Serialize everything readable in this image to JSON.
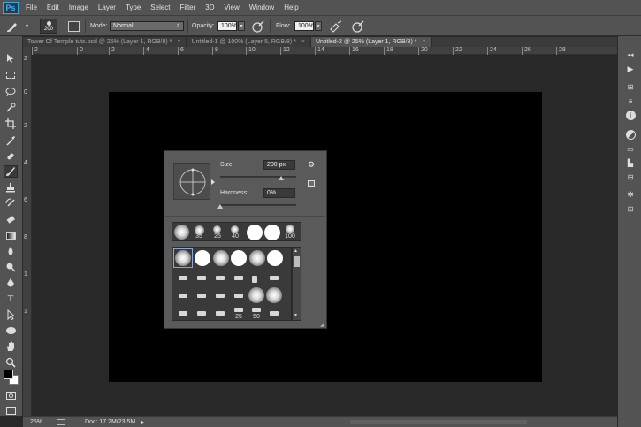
{
  "app": {
    "logo": "Ps",
    "accent": "#31a8ff"
  },
  "menu": [
    "File",
    "Edit",
    "Image",
    "Layer",
    "Type",
    "Select",
    "Filter",
    "3D",
    "View",
    "Window",
    "Help"
  ],
  "options": {
    "brush_size": "200",
    "mode_label": "Mode:",
    "mode_value": "Normal",
    "opacity_label": "Opacity:",
    "opacity_value": "100%",
    "flow_label": "Flow:",
    "flow_value": "100%"
  },
  "tabs": [
    {
      "label": "Tower Of Temple tuts.psd @ 25% (Layer 1, RGB/8) *",
      "active": false
    },
    {
      "label": "Untitled-1 @ 100% (Layer 5, RGB/8) *",
      "active": false
    },
    {
      "label": "Untitled-2 @ 25% (Layer 1, RGB/8) *",
      "active": true
    }
  ],
  "tab_close": "×",
  "ruler": {
    "h": [
      "2",
      "0",
      "2",
      "4",
      "6",
      "8",
      "10",
      "12",
      "14",
      "16",
      "18",
      "20",
      "22",
      "24",
      "26",
      "28"
    ],
    "v": [
      "2",
      "0",
      "2",
      "4",
      "6",
      "8",
      "1",
      "1"
    ]
  },
  "brush_panel": {
    "size_label": "Size:",
    "size_value": "200 px",
    "hardness_label": "Hardness:",
    "hardness_value": "0%",
    "size_slider": 0.8,
    "hardness_slider": 0.0,
    "recent_numbers": [
      "35",
      "25",
      "40",
      "100"
    ],
    "preset_numbers": [
      "25",
      "50"
    ]
  },
  "status": {
    "zoom": "25%",
    "doc": "Doc: 17.2M/23.5M"
  }
}
